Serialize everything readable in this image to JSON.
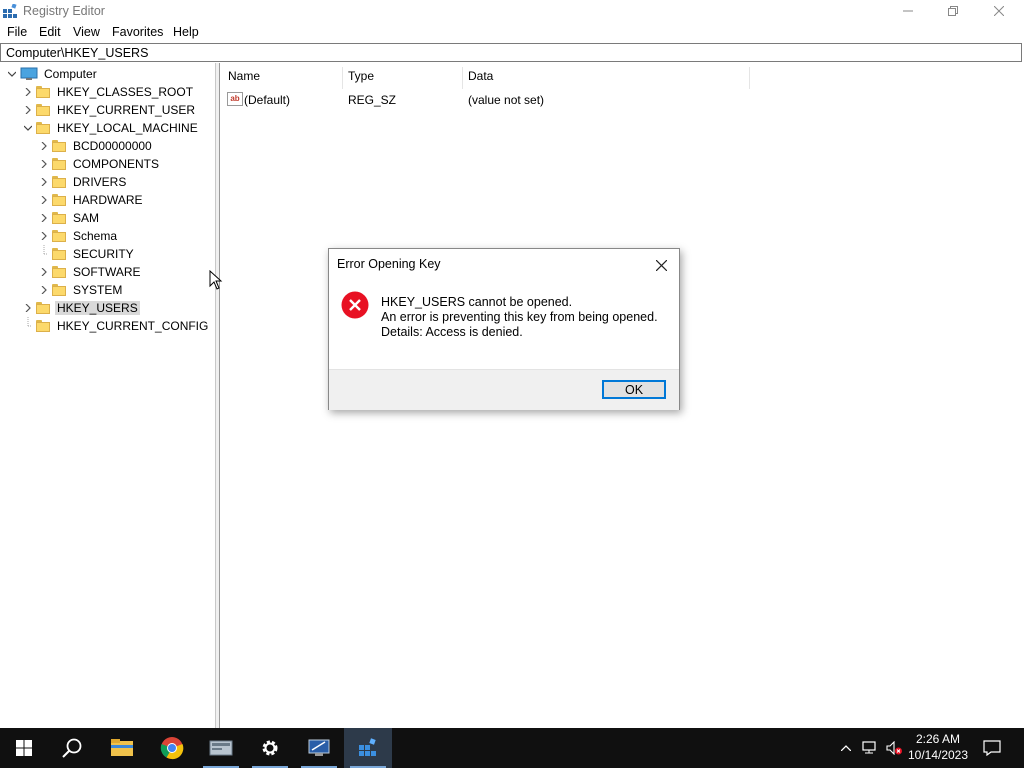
{
  "window": {
    "title": "Registry Editor",
    "minimize_icon": "minimize-icon",
    "maximize_icon": "restore-icon",
    "close_icon": "close-icon"
  },
  "menu": {
    "file": "File",
    "edit": "Edit",
    "view": "View",
    "favorites": "Favorites",
    "help": "Help"
  },
  "address": "Computer\\HKEY_USERS",
  "tree": {
    "root": "Computer",
    "items": [
      {
        "label": "HKEY_CLASSES_ROOT"
      },
      {
        "label": "HKEY_CURRENT_USER"
      },
      {
        "label": "HKEY_LOCAL_MACHINE"
      },
      {
        "label": "BCD00000000"
      },
      {
        "label": "COMPONENTS"
      },
      {
        "label": "DRIVERS"
      },
      {
        "label": "HARDWARE"
      },
      {
        "label": "SAM"
      },
      {
        "label": "Schema"
      },
      {
        "label": "SECURITY"
      },
      {
        "label": "SOFTWARE"
      },
      {
        "label": "SYSTEM"
      },
      {
        "label": "HKEY_USERS"
      },
      {
        "label": "HKEY_CURRENT_CONFIG"
      }
    ]
  },
  "list": {
    "columns": [
      "Name",
      "Type",
      "Data"
    ],
    "rows": [
      {
        "name": "(Default)",
        "type": "REG_SZ",
        "data": "(value not set)"
      }
    ]
  },
  "dialog": {
    "title": "Error Opening Key",
    "line1": "HKEY_USERS cannot be opened.",
    "line2": "An error is preventing this key from being opened.",
    "line3": "Details: Access is denied.",
    "ok": "OK"
  },
  "taskbar": {
    "time": "2:26 AM",
    "date": "10/14/2023"
  },
  "colors": {
    "accent": "#0078d7",
    "error": "#e81123",
    "taskbar": "#101010"
  }
}
